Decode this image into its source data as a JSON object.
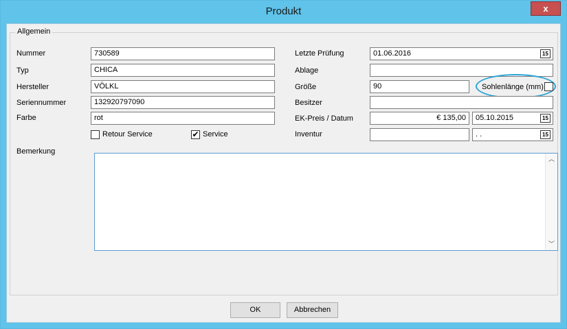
{
  "window": {
    "title": "Produkt",
    "close_label": "x"
  },
  "group": {
    "legend": "Allgemein"
  },
  "fields": {
    "nummer": {
      "label": "Nummer",
      "value": "730589"
    },
    "typ": {
      "label": "Typ",
      "value": "CHICA"
    },
    "hersteller": {
      "label": "Hersteller",
      "value": "VÖLKL"
    },
    "seriennummer": {
      "label": "Seriennummer",
      "value": "132920797090"
    },
    "farbe": {
      "label": "Farbe",
      "value": "rot"
    },
    "letzte_pruefung": {
      "label": "Letzte Prüfung",
      "value": "01.06.2016"
    },
    "ablage": {
      "label": "Ablage",
      "value": ""
    },
    "groesse": {
      "label": "Größe",
      "value": "90"
    },
    "sohlenlaenge": {
      "label": "Sohlenlänge (mm)",
      "checked": false
    },
    "besitzer": {
      "label": "Besitzer",
      "value": ""
    },
    "ek_preis": {
      "label": "EK-Preis / Datum",
      "price": "€ 135,00",
      "date": "05.10.2015"
    },
    "inventur": {
      "label": "Inventur",
      "value": "",
      "date": " .  ."
    },
    "bemerkung": {
      "label": "Bemerkung",
      "value": ""
    }
  },
  "checkboxes": {
    "retour_service": {
      "label": "Retour Service",
      "checked": false
    },
    "service": {
      "label": "Service",
      "checked": true
    }
  },
  "calendar_icon_text": "15",
  "buttons": {
    "ok": "OK",
    "cancel": "Abbrechen"
  },
  "colors": {
    "titlebar": "#5fc3ea",
    "close": "#c75050",
    "highlight": "#29a3d6"
  }
}
